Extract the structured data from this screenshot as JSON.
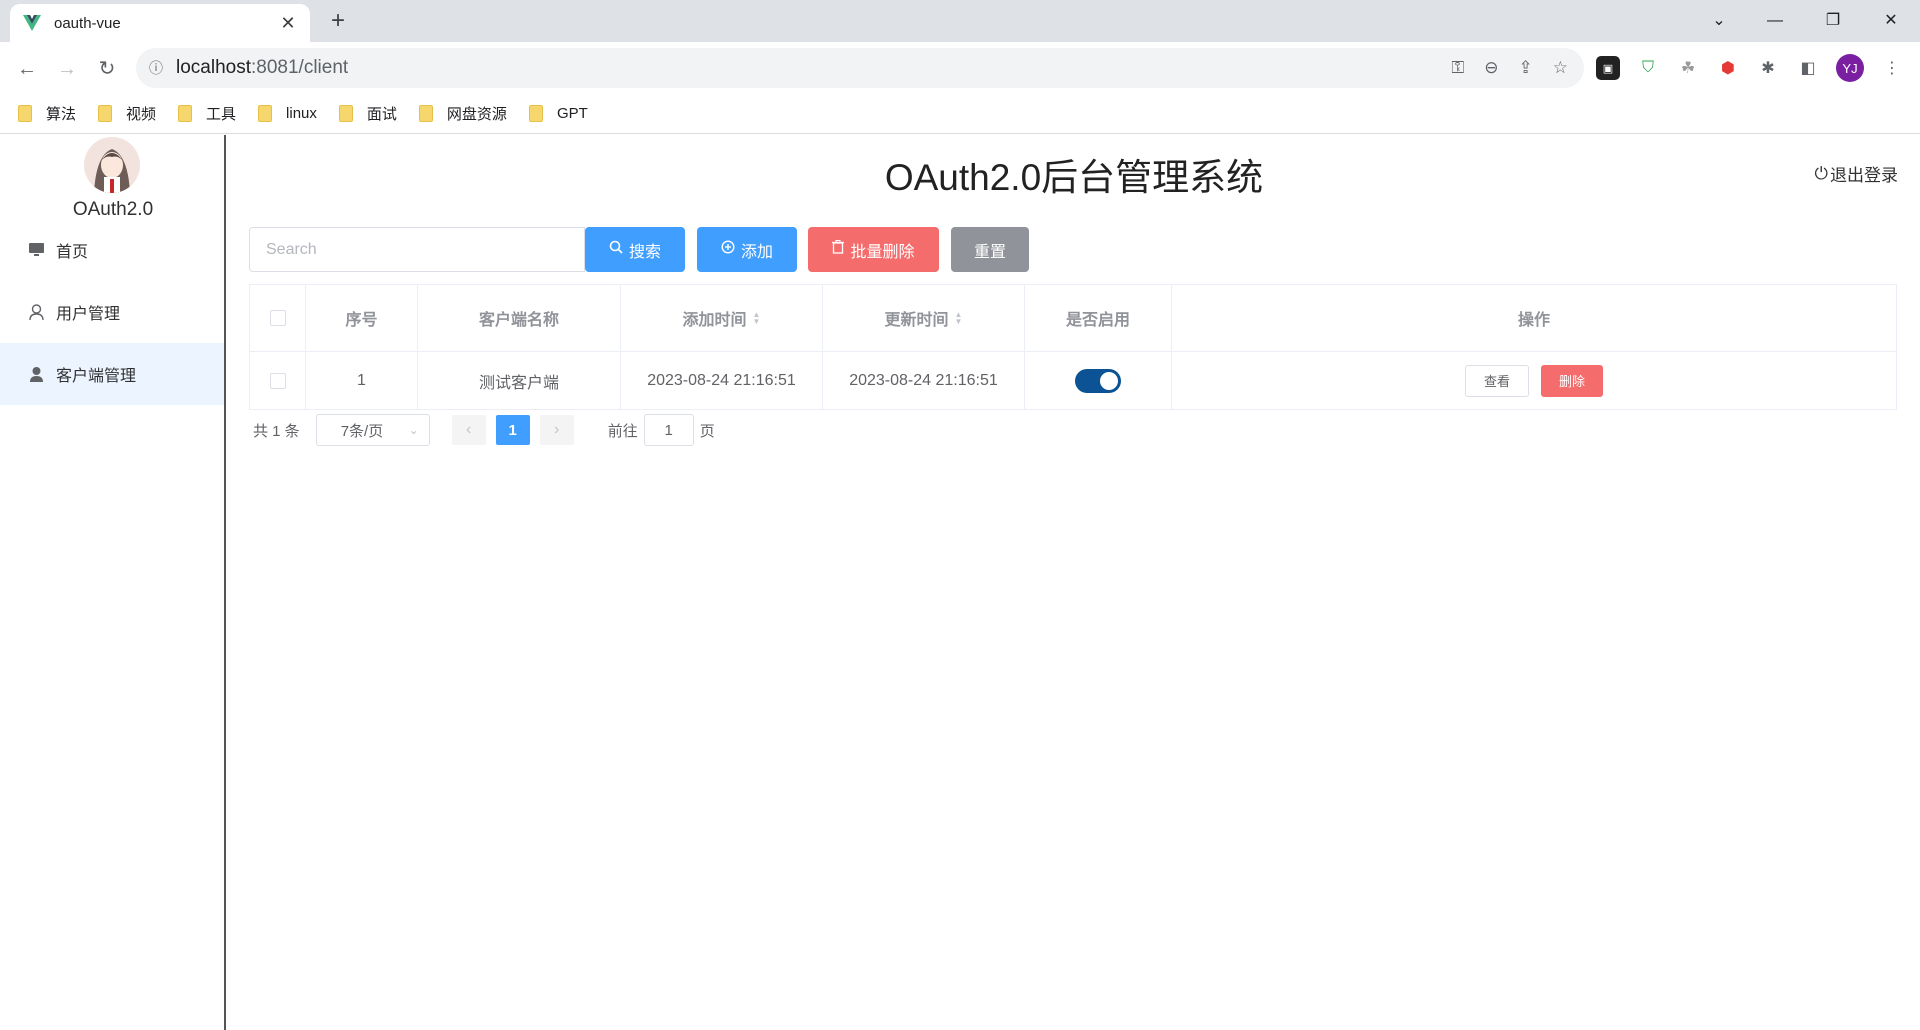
{
  "browser": {
    "tab_title": "oauth-vue",
    "url_host": "localhost",
    "url_rest": ":8081/client",
    "profile_initials": "YJ",
    "bookmarks": [
      "算法",
      "视频",
      "工具",
      "linux",
      "面试",
      "网盘资源",
      "GPT"
    ]
  },
  "sidebar": {
    "logo_text": "OAuth2.0",
    "items": [
      {
        "label": "首页",
        "icon": "monitor-icon"
      },
      {
        "label": "用户管理",
        "icon": "user-icon"
      },
      {
        "label": "客户端管理",
        "icon": "user-filled-icon",
        "active": true
      }
    ]
  },
  "header": {
    "title": "OAuth2.0后台管理系统",
    "logout": "退出登录"
  },
  "toolbar": {
    "search_placeholder": "Search",
    "search_label": "搜索",
    "add_label": "添加",
    "batch_delete_label": "批量删除",
    "reset_label": "重置"
  },
  "table": {
    "headers": [
      "序号",
      "客户端名称",
      "添加时间",
      "更新时间",
      "是否启用",
      "操作"
    ],
    "rows": [
      {
        "index": "1",
        "name": "测试客户端",
        "created": "2023-08-24 21:16:51",
        "updated": "2023-08-24 21:16:51",
        "enabled": true,
        "view_label": "查看",
        "delete_label": "删除"
      }
    ]
  },
  "pagination": {
    "total": "共 1 条",
    "page_size": "7条/页",
    "current_page": "1",
    "goto_prefix": "前往",
    "goto_value": "1",
    "goto_suffix": "页"
  },
  "colors": {
    "primary": "#409eff",
    "danger": "#f56c6c",
    "info": "#909399",
    "switch_on": "#0b5394"
  }
}
